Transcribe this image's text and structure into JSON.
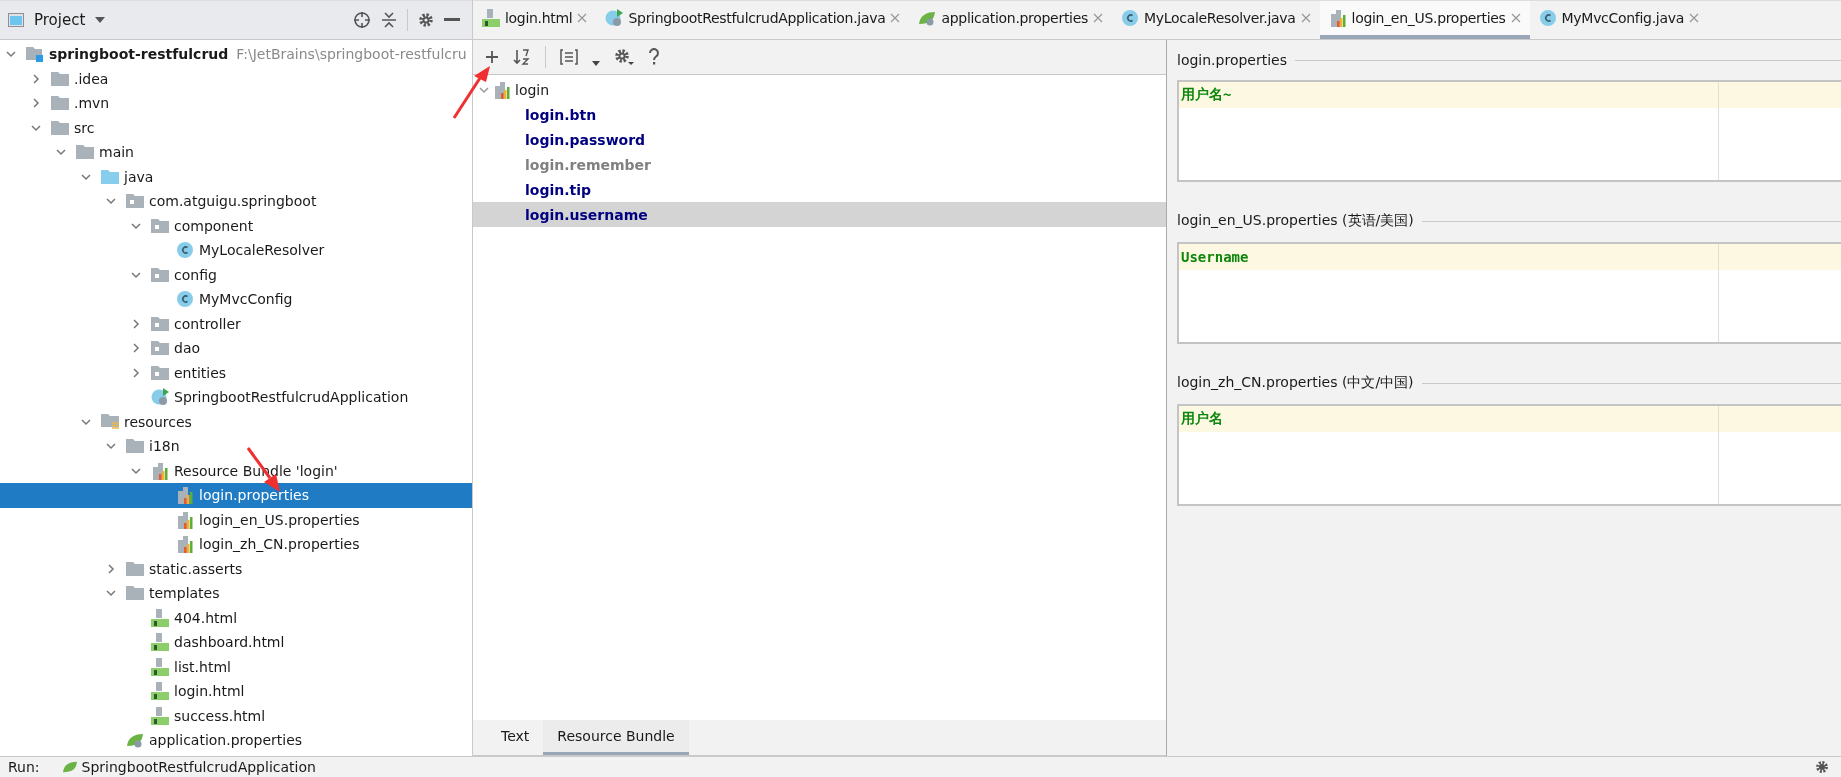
{
  "project_panel": {
    "title": "Project",
    "tree": [
      {
        "label": "springboot-restfulcrud",
        "path": "F:\\JetBrains\\springboot-restfulcru",
        "kind": "module",
        "expanded": true,
        "selected": false,
        "children": [
          {
            "label": ".idea",
            "kind": "folder",
            "expanded": false,
            "selected": false
          },
          {
            "label": ".mvn",
            "kind": "folder",
            "expanded": false,
            "selected": false
          },
          {
            "label": "src",
            "kind": "folder",
            "expanded": true,
            "selected": false,
            "children": [
              {
                "label": "main",
                "kind": "folder",
                "expanded": true,
                "selected": false,
                "children": [
                  {
                    "label": "java",
                    "kind": "source",
                    "expanded": true,
                    "selected": false,
                    "children": [
                      {
                        "label": "com.atguigu.springboot",
                        "kind": "package",
                        "expanded": true,
                        "selected": false,
                        "children": [
                          {
                            "label": "component",
                            "kind": "package",
                            "expanded": true,
                            "selected": false,
                            "children": [
                              {
                                "label": "MyLocaleResolver",
                                "kind": "class",
                                "selected": false
                              }
                            ]
                          },
                          {
                            "label": "config",
                            "kind": "package",
                            "expanded": true,
                            "selected": false,
                            "children": [
                              {
                                "label": "MyMvcConfig",
                                "kind": "class",
                                "selected": false
                              }
                            ]
                          },
                          {
                            "label": "controller",
                            "kind": "package",
                            "expanded": false,
                            "selected": false
                          },
                          {
                            "label": "dao",
                            "kind": "package",
                            "expanded": false,
                            "selected": false
                          },
                          {
                            "label": "entities",
                            "kind": "package",
                            "expanded": false,
                            "selected": false
                          },
                          {
                            "label": "SpringbootRestfulcrudApplication",
                            "kind": "spring",
                            "selected": false
                          }
                        ]
                      }
                    ]
                  },
                  {
                    "label": "resources",
                    "kind": "resources",
                    "expanded": true,
                    "selected": false,
                    "children": [
                      {
                        "label": "i18n",
                        "kind": "folder",
                        "expanded": true,
                        "selected": false,
                        "children": [
                          {
                            "label": "Resource Bundle 'login'",
                            "kind": "bundle",
                            "expanded": true,
                            "selected": false,
                            "children": [
                              {
                                "label": "login.properties",
                                "kind": "properties",
                                "selected": true
                              },
                              {
                                "label": "login_en_US.properties",
                                "kind": "properties",
                                "selected": false
                              },
                              {
                                "label": "login_zh_CN.properties",
                                "kind": "properties",
                                "selected": false
                              }
                            ]
                          }
                        ]
                      },
                      {
                        "label": "static.asserts",
                        "kind": "folder",
                        "expanded": false,
                        "selected": false
                      },
                      {
                        "label": "templates",
                        "kind": "folder",
                        "expanded": true,
                        "selected": false,
                        "children": [
                          {
                            "label": "404.html",
                            "kind": "html",
                            "selected": false
                          },
                          {
                            "label": "dashboard.html",
                            "kind": "html",
                            "selected": false
                          },
                          {
                            "label": "list.html",
                            "kind": "html",
                            "selected": false
                          },
                          {
                            "label": "login.html",
                            "kind": "html",
                            "selected": false
                          },
                          {
                            "label": "success.html",
                            "kind": "html",
                            "selected": false
                          }
                        ]
                      },
                      {
                        "label": "application.properties",
                        "kind": "spring-props",
                        "selected": false
                      }
                    ]
                  }
                ]
              }
            ]
          }
        ]
      }
    ]
  },
  "editor_tabs": [
    {
      "label": "login.html",
      "kind": "html",
      "selected": false
    },
    {
      "label": "SpringbootRestfulcrudApplication.java",
      "kind": "spring",
      "selected": false
    },
    {
      "label": "application.properties",
      "kind": "spring-props",
      "selected": false
    },
    {
      "label": "MyLocaleResolver.java",
      "kind": "class",
      "selected": false
    },
    {
      "label": "login_en_US.properties",
      "kind": "properties",
      "selected": true
    },
    {
      "label": "MyMvcConfig.java",
      "kind": "class",
      "selected": false
    }
  ],
  "bundle_editor": {
    "root": {
      "label": "login",
      "expanded": true,
      "keys": [
        {
          "label": "login.btn",
          "complete": true,
          "selected": false
        },
        {
          "label": "login.password",
          "complete": true,
          "selected": false
        },
        {
          "label": "login.remember",
          "complete": false,
          "selected": false
        },
        {
          "label": "login.tip",
          "complete": true,
          "selected": false
        },
        {
          "label": "login.username",
          "complete": true,
          "selected": true
        }
      ]
    },
    "view_tabs": [
      {
        "label": "Text",
        "selected": false
      },
      {
        "label": "Resource Bundle",
        "selected": true
      }
    ]
  },
  "locales": [
    {
      "title": "login.properties",
      "value": "用户名~"
    },
    {
      "title": "login_en_US.properties (英语/美国)",
      "value": "Username"
    },
    {
      "title": "login_zh_CN.properties (中文/中国)",
      "value": "用户名"
    }
  ],
  "run_bar": {
    "label": "Run:",
    "config": "SpringbootRestfulcrudApplication"
  }
}
